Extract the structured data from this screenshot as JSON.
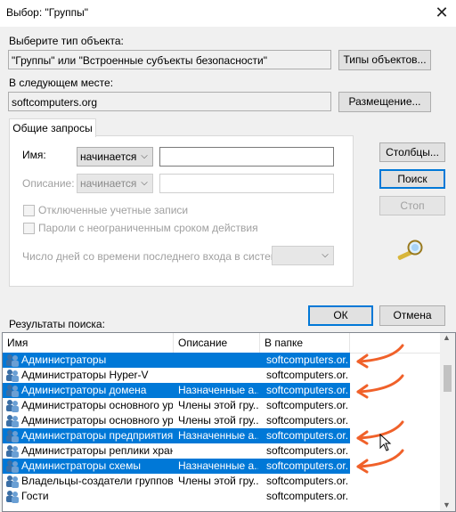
{
  "window": {
    "title": "Выбор: \"Группы\"",
    "close_glyph": "✕"
  },
  "object_type": {
    "label": "Выберите тип объекта:",
    "value": "\"Группы\" или \"Встроенные субъекты безопасности\"",
    "button": "Типы объектов..."
  },
  "location": {
    "label": "В следующем месте:",
    "value": "softcomputers.org",
    "button": "Размещение..."
  },
  "common_queries": {
    "tab": "Общие запросы",
    "name_label": "Имя:",
    "name_mode": "начинается с",
    "desc_label": "Описание:",
    "desc_mode": "начинается с",
    "disabled_accounts": "Отключенные учетные записи",
    "non_expiring_pw": "Пароли с неограниченным сроком действия",
    "days_label": "Число дней со времени последнего входа в систему:"
  },
  "buttons": {
    "columns": "Столбцы...",
    "search": "Поиск",
    "stop": "Стоп",
    "ok": "ОК",
    "cancel": "Отмена"
  },
  "results": {
    "label": "Результаты поиска:",
    "columns": [
      "Имя",
      "Описание",
      "В папке"
    ],
    "rows": [
      {
        "name": "Администраторы",
        "desc": "",
        "folder": "softcomputers.or...",
        "selected": true
      },
      {
        "name": "Администраторы Hyper-V",
        "desc": "",
        "folder": "softcomputers.or...",
        "selected": false
      },
      {
        "name": "Администраторы домена",
        "desc": "Назначенные а...",
        "folder": "softcomputers.or...",
        "selected": true
      },
      {
        "name": "Администраторы основного ур...",
        "desc": "Члены этой гру...",
        "folder": "softcomputers.or...",
        "selected": false
      },
      {
        "name": "Администраторы основного ур...",
        "desc": "Члены этой гру...",
        "folder": "softcomputers.or...",
        "selected": false
      },
      {
        "name": "Администраторы предприятия",
        "desc": "Назначенные а...",
        "folder": "softcomputers.or...",
        "selected": true
      },
      {
        "name": "Администраторы реплики хран...",
        "desc": "",
        "folder": "softcomputers.or...",
        "selected": false
      },
      {
        "name": "Администраторы схемы",
        "desc": "Назначенные а...",
        "folder": "softcomputers.or...",
        "selected": true
      },
      {
        "name": "Владельцы-создатели группов...",
        "desc": "Члены этой гру...",
        "folder": "softcomputers.or...",
        "selected": false
      },
      {
        "name": "Гости",
        "desc": "",
        "folder": "softcomputers.or...",
        "selected": false
      }
    ]
  },
  "colors": {
    "selection": "#0078d7",
    "annotation_arrow": "#f0612a"
  }
}
